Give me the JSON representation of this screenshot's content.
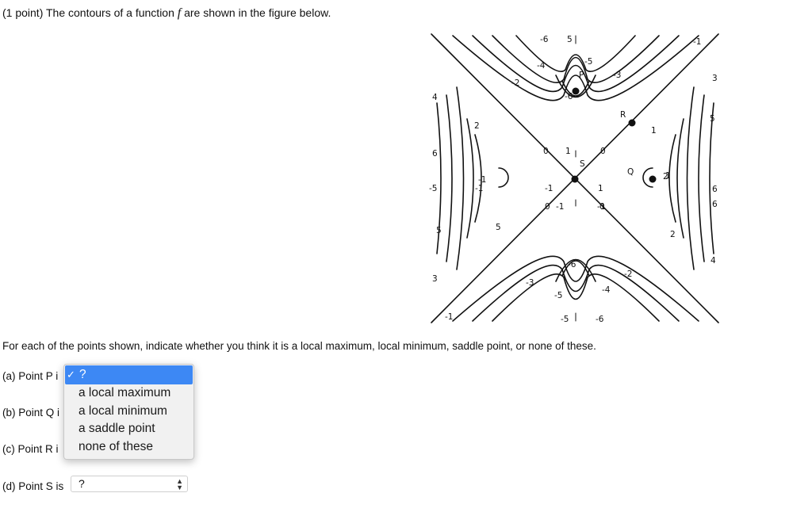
{
  "question": {
    "prefix": "(1 point) The contours of a function ",
    "function_symbol": "f",
    "suffix": " are shown in the figure below."
  },
  "figure": {
    "point_labels": [
      "P",
      "Q",
      "R",
      "S"
    ],
    "contour_labels": [
      "-6",
      "5",
      "-5",
      "-4",
      "-3",
      "-2",
      "-1",
      "1",
      "2",
      "3",
      "4",
      "5",
      "6",
      "0",
      "1",
      "-1",
      "0",
      "0",
      "0",
      "-1",
      "1",
      "-1",
      "-6",
      "-6",
      "-5",
      "-4",
      "-3",
      "-2",
      "-1",
      "-5",
      "-6",
      "2",
      "3",
      "4",
      "5",
      "6",
      "6",
      "5",
      "-5",
      "1",
      "-1",
      "2",
      "-1"
    ]
  },
  "instruction": "For each of the points shown, indicate whether you think it is a local maximum, local minimum, saddle point, or none of these.",
  "parts": [
    {
      "label": "(a) Point P i"
    },
    {
      "label": "(b) Point Q i"
    },
    {
      "label": "(c) Point R i"
    },
    {
      "label": "(d) Point S is",
      "value": "?"
    }
  ],
  "dropdown": {
    "selected": "?",
    "check_glyph": "✓",
    "options": [
      "a local maximum",
      "a local minimum",
      "a saddle point",
      "none of these"
    ]
  }
}
